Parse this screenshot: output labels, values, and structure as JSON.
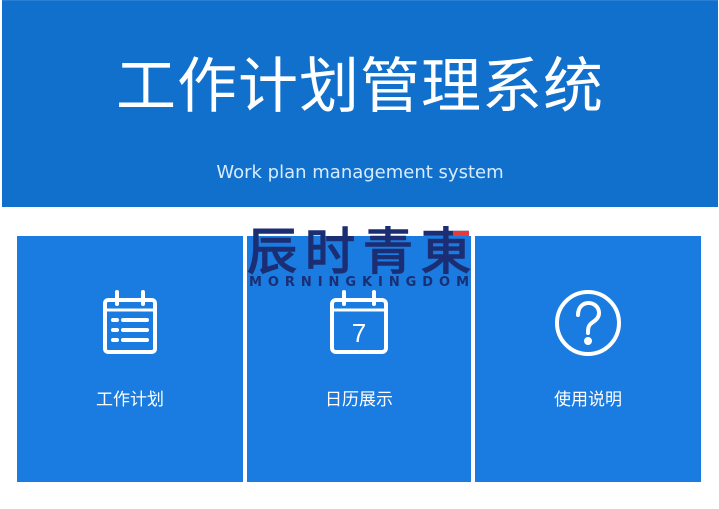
{
  "header": {
    "title": "工作计划管理系统",
    "subtitle": "Work plan management system"
  },
  "cards": [
    {
      "label": "工作计划",
      "icon": "calendar-list-icon"
    },
    {
      "label": "日历展示",
      "icon": "calendar-day-icon",
      "icon_text": "7"
    },
    {
      "label": "使用说明",
      "icon": "help-circle-icon"
    }
  ],
  "watermark": {
    "text": "辰时青東",
    "subtext": "MORNINGKINGDOM"
  },
  "colors": {
    "header_bg": "#1170cc",
    "card_bg": "#1a7be0",
    "text": "#ffffff",
    "logo_blue": "#1c2e73",
    "logo_red": "#e83a3a"
  }
}
